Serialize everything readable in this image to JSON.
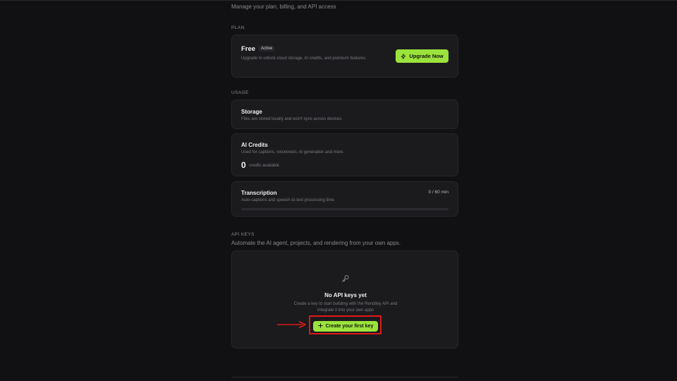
{
  "header": {
    "subtitle": "Manage your plan, billing, and API access"
  },
  "plan": {
    "section_label": "PLAN",
    "name": "Free",
    "badge": "Active",
    "description": "Upgrade to unlock cloud storage, AI credits, and premium features.",
    "upgrade_label": "Upgrade Now",
    "upgrade_icon": "bolt-icon"
  },
  "usage": {
    "section_label": "USAGE",
    "storage": {
      "title": "Storage",
      "description": "Files are stored locally and won't sync across devices."
    },
    "ai_credits": {
      "title": "AI Credits",
      "description": "Used for captions, voiceovers, AI generation and more.",
      "count": "0",
      "count_label": "credits available"
    },
    "transcription": {
      "title": "Transcription",
      "value": "0 / 60 min",
      "description": "Auto-captions and speech-to-text processing time.",
      "progress_fraction": 0
    }
  },
  "api_keys": {
    "section_label": "API KEYS",
    "description": "Automate the AI agent, projects, and rendering from your own apps.",
    "empty_icon": "key-icon",
    "empty_title": "No API keys yet",
    "empty_description": "Create a key to start building with the Renditey API and integrate it into your own apps",
    "create_label": "Create your first key",
    "create_icon": "plus-icon"
  },
  "colors": {
    "accent": "#9be33c",
    "background": "#111113",
    "card": "#1b1b1e",
    "annotation": "#e01818"
  }
}
